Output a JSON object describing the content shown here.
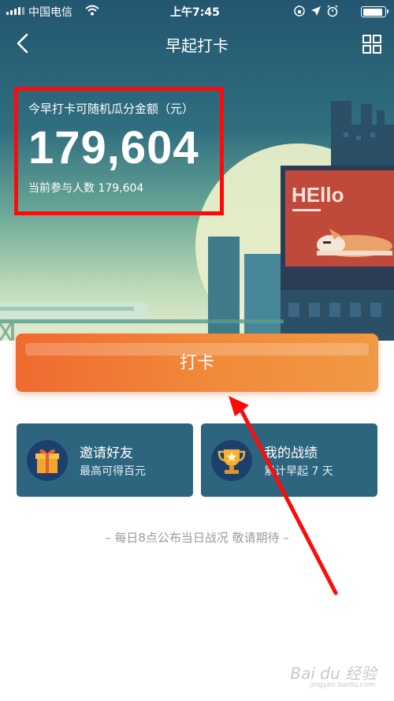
{
  "status_bar": {
    "carrier": "中国电信",
    "time": "上午7:45",
    "battery_level": 0.9
  },
  "nav": {
    "title": "早起打卡",
    "icons": [
      "back-icon",
      "grid-icon"
    ]
  },
  "hero": {
    "prize_label": "今早打卡可随机瓜分金额（元）",
    "prize_amount": "179,604",
    "participants": "当前参与人数 179,604",
    "billboard_text": "HEllo"
  },
  "punch_button": {
    "label": "打卡"
  },
  "cards": [
    {
      "title": "邀请好友",
      "subtitle": "最高可得百元",
      "icon": "gift-icon"
    },
    {
      "title": "我的战绩",
      "subtitle": "累计早起 7 天",
      "icon": "trophy-icon"
    }
  ],
  "footer_note": "– 每日8点公布当日战况 敬请期待 –",
  "watermark": {
    "text": "Bai du 经验",
    "sub": "jingyan.baidu.com"
  },
  "colors": {
    "annotation": "#ff0a0a",
    "punch_start": "#ef6a30",
    "punch_end": "#f19944",
    "card": "#2d657f"
  }
}
